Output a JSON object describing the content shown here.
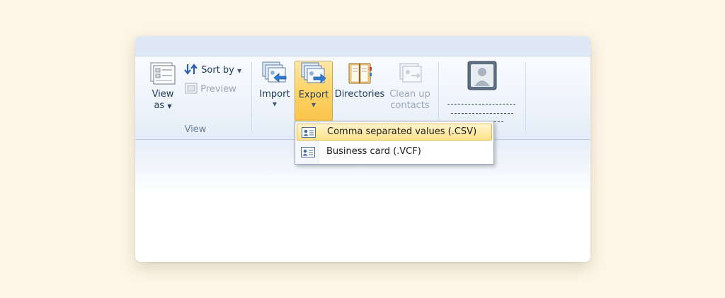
{
  "ribbon": {
    "view_group": {
      "view_as": {
        "line1": "View",
        "line2": "as"
      },
      "sort_by": "Sort by",
      "preview": "Preview",
      "label": "View"
    },
    "actions": {
      "import": "Import",
      "export": "Export",
      "directories": "Directories",
      "clean_up": {
        "line1": "Clean up",
        "line2": "contacts"
      }
    }
  },
  "export_menu": {
    "items": [
      {
        "label": "Comma separated values (.CSV)",
        "highlighted": true
      },
      {
        "label": "Business card (.VCF)",
        "highlighted": false
      }
    ]
  },
  "icons": {
    "view_as": "view-as-icon",
    "sort": "sort-arrows-icon",
    "preview": "preview-pane-icon",
    "import": "import-contacts-icon",
    "export": "export-contacts-icon",
    "directories": "address-book-icon",
    "clean_up": "clean-up-contacts-icon",
    "contact": "contact-card-icon",
    "menu_item": "contact-card-icon"
  },
  "colors": {
    "accent_pressed": "#ffd56b",
    "ribbon_bg": "#eef4fb",
    "text": "#1e395b",
    "disabled": "#9aa6b8",
    "menu_highlight": "#ffe28a"
  }
}
